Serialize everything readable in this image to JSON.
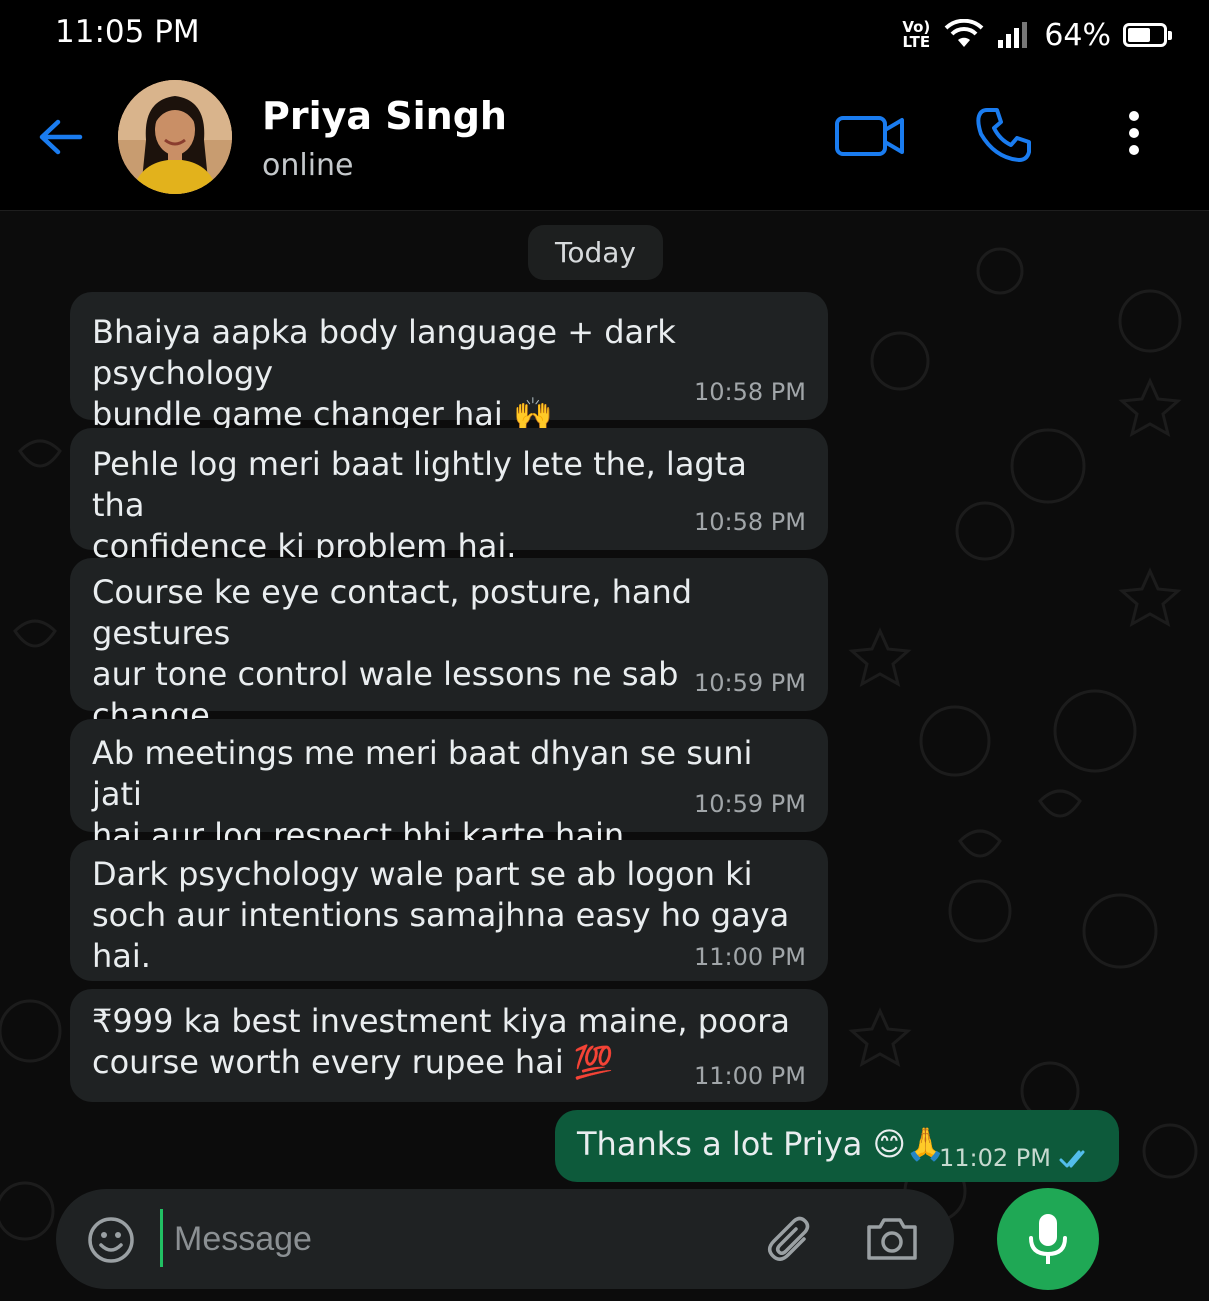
{
  "status_bar": {
    "time": "11:05 PM",
    "volte": "Vo) LTE",
    "battery_text": "64%",
    "battery_level": 0.64
  },
  "header": {
    "name": "Priya Singh",
    "status": "online"
  },
  "date_chip": "Today",
  "messages": [
    {
      "text": "Bhaiya aapka body language + dark psychology\nbundle game changer hai 🙌",
      "time": "10:58 PM"
    },
    {
      "text": "Pehle log meri baat lightly lete the, lagta tha\nconfidence ki problem hai.",
      "time": "10:58 PM"
    },
    {
      "text": "Course ke eye contact, posture, hand gestures\naur tone control wale lessons ne sab change\nkar diya.",
      "time": "10:59 PM"
    },
    {
      "text": "Ab meetings me meri baat dhyan se suni jati\nhai aur log respect bhi karte hain.",
      "time": "10:59 PM"
    },
    {
      "text": "Dark psychology wale part se ab logon ki\nsoch aur intentions samajhna easy ho gaya hai.",
      "time": "11:00 PM"
    },
    {
      "text": "₹999 ka best investment kiya maine, poora\ncourse worth every rupee hai 💯",
      "time": "11:00 PM"
    }
  ],
  "outgoing": {
    "text": "Thanks a lot Priya 😊🙏",
    "time": "11:02 PM",
    "status": "read"
  },
  "composer": {
    "placeholder": "Message"
  },
  "colors": {
    "accent_blue": "#1a7cf0",
    "outgoing_bubble": "#0d5a3b",
    "incoming_bubble": "#1f2223",
    "mic_green": "#1fa855",
    "read_tick": "#53bdeb"
  }
}
